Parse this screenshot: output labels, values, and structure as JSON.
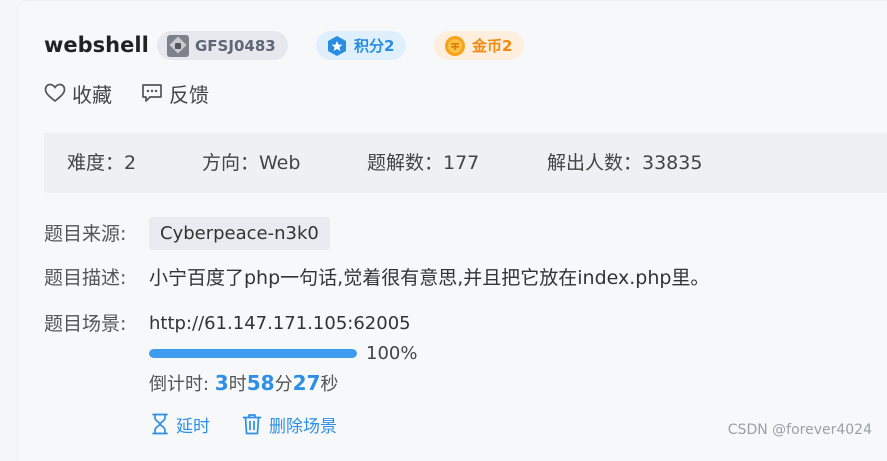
{
  "challenge": {
    "title": "webshell",
    "badges": {
      "id": "GFSJ0483",
      "points": "积分2",
      "coins": "金币2"
    }
  },
  "actions": {
    "favorite": "收藏",
    "feedback": "反馈"
  },
  "stats": {
    "difficulty": "难度：2",
    "direction": "方向：Web",
    "solves": "题解数：177",
    "solvers": "解出人数：33835"
  },
  "info": {
    "source_label": "题目来源:",
    "source_value": "Cyberpeace-n3k0",
    "description_label": "题目描述:",
    "description_value": "小宁百度了php一句话,觉着很有意思,并且把它放在index.php里。",
    "scene_label": "题目场景:",
    "scene_url": "http://61.147.171.105:62005"
  },
  "progress": {
    "percent": 100,
    "text": "100%"
  },
  "countdown": {
    "prefix": "倒计时: ",
    "hours": "3",
    "hours_unit": "时",
    "minutes": "58",
    "minutes_unit": "分",
    "seconds": "27",
    "seconds_unit": "秒"
  },
  "buttons": {
    "extend": "延时",
    "delete_scene": "删除场景"
  },
  "watermark": "CSDN @forever4024",
  "colors": {
    "accent": "#2d8fe8",
    "progress": "#3d9cf0",
    "points_badge": "#dff0fc",
    "coin_badge": "#fdeedd"
  }
}
